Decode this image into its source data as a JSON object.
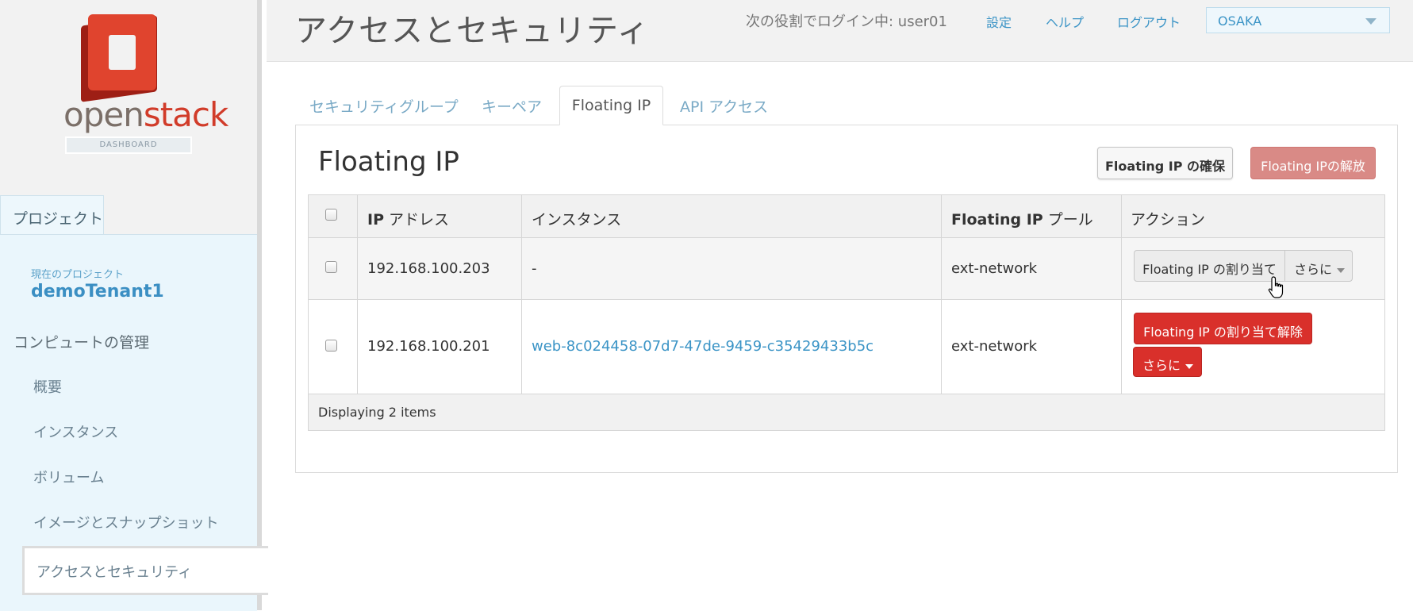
{
  "brand": {
    "wordmark_part1": "open",
    "wordmark_part2": "stack",
    "dashboard_label": "DASHBOARD",
    "logo_color": "#e0442e"
  },
  "sidebar": {
    "project_tab": "プロジェクト",
    "current_project_label": "現在のプロジェクト",
    "current_project_name": "demoTenant1",
    "section_header": "コンピュートの管理",
    "items": [
      {
        "label": "概要"
      },
      {
        "label": "インスタンス"
      },
      {
        "label": "ボリューム"
      },
      {
        "label": "イメージとスナップショット"
      },
      {
        "label": "アクセスとセキュリティ",
        "active": true
      }
    ]
  },
  "header": {
    "page_title": "アクセスとセキュリティ",
    "login_info": "次の役割でログイン中: user01",
    "links": {
      "settings": "設定",
      "help": "ヘルプ",
      "logout": "ログアウト"
    },
    "region": {
      "selected": "OSAKA"
    }
  },
  "tabs": [
    {
      "label": "セキュリティグループ"
    },
    {
      "label": "キーペア"
    },
    {
      "label": "Floating IP",
      "active": true
    },
    {
      "label": "API アクセス"
    }
  ],
  "panel": {
    "title": "Floating IP",
    "allocate_button": "Floating IP の確保",
    "release_button": "Floating IPの解放"
  },
  "table": {
    "columns": {
      "ip_prefix": "IP",
      "ip_suffix": " アドレス",
      "instance": "インスタンス",
      "pool_prefix": "Floating IP",
      "pool_suffix": " プール",
      "actions": "アクション"
    },
    "rows": [
      {
        "ip": "192.168.100.203",
        "instance": "-",
        "pool": "ext-network",
        "primary_action": "Floating IP の割り当て",
        "more_action": "さらに"
      },
      {
        "ip": "192.168.100.201",
        "instance": "web-8c024458-07d7-47de-9459-c35429433b5c",
        "pool": "ext-network",
        "primary_action": "Floating IP の割り当て解除",
        "more_action": "さらに"
      }
    ],
    "footer": "Displaying 2 items"
  },
  "colors": {
    "accent_link": "#3b94c6",
    "danger": "#d9302b",
    "danger_disabled": "#d98a86"
  }
}
